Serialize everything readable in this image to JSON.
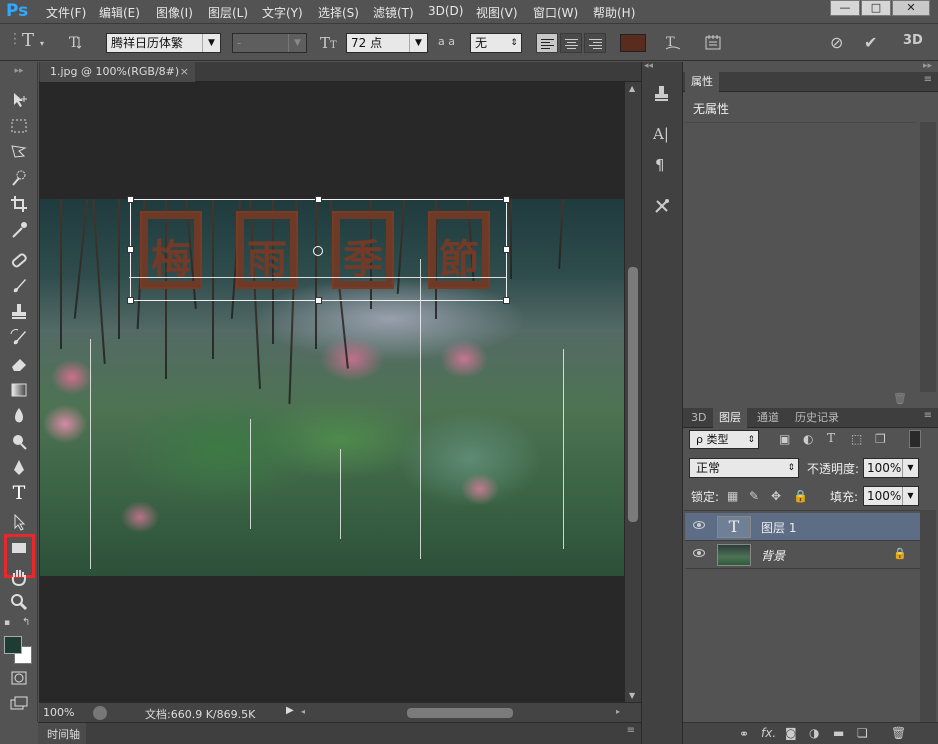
{
  "app": {
    "logo": "Ps",
    "accent": "#31a8ff"
  },
  "menu": [
    "文件(F)",
    "编辑(E)",
    "图像(I)",
    "图层(L)",
    "文字(Y)",
    "选择(S)",
    "滤镜(T)",
    "3D(D)",
    "视图(V)",
    "窗口(W)",
    "帮助(H)"
  ],
  "window": {
    "minimize": "—",
    "restore": "□",
    "close": "✕"
  },
  "options": {
    "tool_glyph": "T",
    "font_family": "腾祥日历体繁",
    "font_style": "-",
    "font_size": "72 点",
    "aa_label": "a a",
    "antialias": "无",
    "text_color": "#5a2c1e",
    "threed": "3D"
  },
  "document": {
    "tab_title": "1.jpg @ 100%(RGB/8#)",
    "tab_close": "×",
    "seal_chars": [
      "梅",
      "雨",
      "季",
      "節"
    ],
    "seal_color": "#7b3a24"
  },
  "status": {
    "zoom": "100%",
    "doc_info": "文档:660.9 K/869.5K"
  },
  "timeline": {
    "label": "时间轴"
  },
  "properties": {
    "tab": "属性",
    "empty": "无属性"
  },
  "layers_panel": {
    "tabs": [
      "3D",
      "图层",
      "通道",
      "历史记录"
    ],
    "filter": "ρ 类型",
    "blend_mode": "正常",
    "opacity_label": "不透明度:",
    "opacity": "100%",
    "lock_label": "锁定:",
    "fill_label": "填充:",
    "fill": "100%",
    "layers": [
      {
        "name": "图层 1",
        "type": "text",
        "thumb_glyph": "T",
        "selected": true
      },
      {
        "name": "背景",
        "type": "image",
        "locked": true,
        "selected": false
      }
    ],
    "footer_icons": [
      "link-icon",
      "fx-icon",
      "mask-icon",
      "adjustment-icon",
      "folder-icon",
      "new-layer-icon",
      "trash-icon"
    ],
    "footer_fx": "fx."
  },
  "colors": {
    "foreground": "#1d3d34",
    "background": "#ffffff"
  }
}
